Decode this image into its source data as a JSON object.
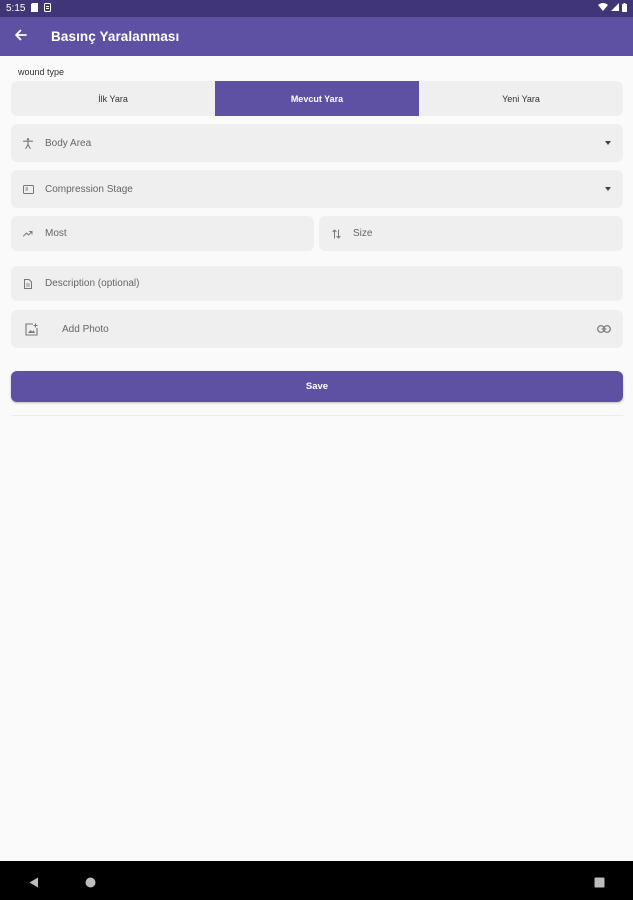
{
  "status_bar": {
    "time": "5:15"
  },
  "app_bar": {
    "title": "Basınç Yaralanması"
  },
  "form": {
    "wound_type_label": "wound type",
    "wound_types": [
      "İlk Yara",
      "Mevcut Yara",
      "Yeni Yara"
    ],
    "selected_wound_type": "Mevcut Yara",
    "body_area_placeholder": "Body Area",
    "compression_stage_placeholder": "Compression Stage",
    "most_placeholder": "Most",
    "size_placeholder": "Size",
    "description_placeholder": "Description (optional)",
    "add_photo_label": "Add Photo",
    "save_label": "Save"
  },
  "colors": {
    "primary": "#5e51a3",
    "status_bar": "#3f3577",
    "field_bg": "#efefef",
    "background": "#fafafa"
  },
  "icons": {
    "back": "arrow-left-icon",
    "body_area": "accessibility-icon",
    "compression_stage": "layers-icon",
    "most": "trending-icon",
    "size": "swap-vertical-icon",
    "description": "document-icon",
    "add_photo": "add-photo-icon",
    "link": "link-icon"
  }
}
